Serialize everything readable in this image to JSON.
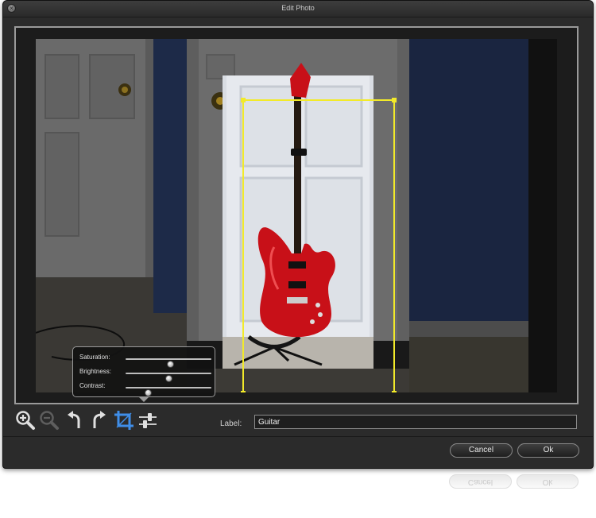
{
  "window": {
    "title": "Edit Photo"
  },
  "adjust_panel": {
    "sliders": [
      {
        "label": "Saturation:",
        "value": 0.52
      },
      {
        "label": "Brightness:",
        "value": 0.5
      },
      {
        "label": "Contrast:",
        "value": 0.26
      }
    ]
  },
  "label_field": {
    "label": "Label:",
    "value": "Guitar"
  },
  "buttons": {
    "cancel": "Cancel",
    "ok": "Ok"
  },
  "colors": {
    "crop_outline": "#f2ea2a",
    "crop_tool_active": "#3f8ee8",
    "guitar_body": "#c81018"
  },
  "tools": [
    {
      "icon": "zoom-in-icon",
      "enabled": true
    },
    {
      "icon": "zoom-out-icon",
      "enabled": false
    },
    {
      "icon": "rotate-left-icon",
      "enabled": true
    },
    {
      "icon": "rotate-right-icon",
      "enabled": true
    },
    {
      "icon": "crop-icon",
      "active": true
    },
    {
      "icon": "adjust-sliders-icon",
      "enabled": true
    }
  ]
}
